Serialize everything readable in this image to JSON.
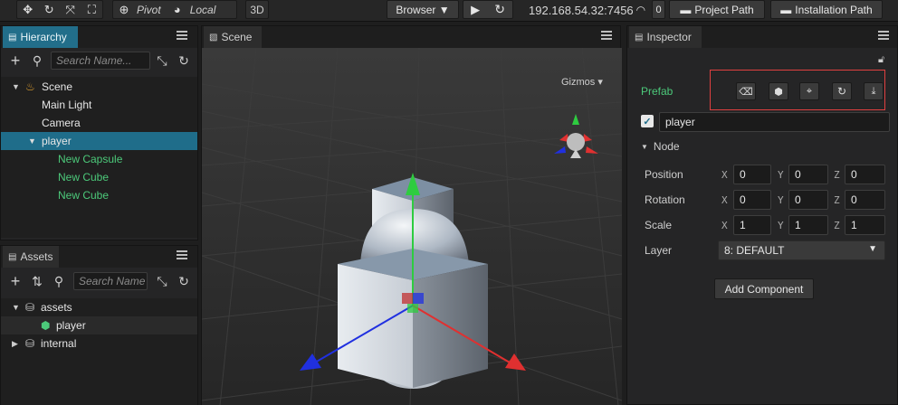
{
  "toolbar": {
    "pivot_label": "Pivot",
    "local_label": "Local",
    "mode_3d": "3D",
    "browser_label": "Browser ▼",
    "ip_address": "192.168.54.32:7456",
    "wifi_count": "0",
    "project_path_label": "Project Path",
    "installation_path_label": "Installation Path"
  },
  "hierarchy": {
    "tab_label": "Hierarchy",
    "search_placeholder": "Search Name...",
    "items": [
      {
        "label": "Scene"
      },
      {
        "label": "Main Light"
      },
      {
        "label": "Camera"
      },
      {
        "label": "player"
      },
      {
        "label": "New Capsule"
      },
      {
        "label": "New Cube"
      },
      {
        "label": "New Cube"
      }
    ]
  },
  "assets": {
    "tab_label": "Assets",
    "search_placeholder": "Search Name",
    "items": [
      {
        "label": "assets"
      },
      {
        "label": "player"
      },
      {
        "label": "internal"
      }
    ]
  },
  "scene": {
    "tab_label": "Scene",
    "gizmos_label": "Gizmos ▾"
  },
  "inspector": {
    "tab_label": "Inspector",
    "prefab_label": "Prefab",
    "node_name": "player",
    "node_section": "Node",
    "position_label": "Position",
    "rotation_label": "Rotation",
    "scale_label": "Scale",
    "layer_label": "Layer",
    "axis_x": "X",
    "axis_y": "Y",
    "axis_z": "Z",
    "position": {
      "x": "0",
      "y": "0",
      "z": "0"
    },
    "rotation": {
      "x": "0",
      "y": "0",
      "z": "0"
    },
    "scale": {
      "x": "1",
      "y": "1",
      "z": "1"
    },
    "layer_value": "8: DEFAULT",
    "add_component_label": "Add Component"
  },
  "colors": {
    "accent_blue": "#226e8a",
    "prefab_green": "#4cc97a",
    "highlight_red": "#e04040"
  }
}
